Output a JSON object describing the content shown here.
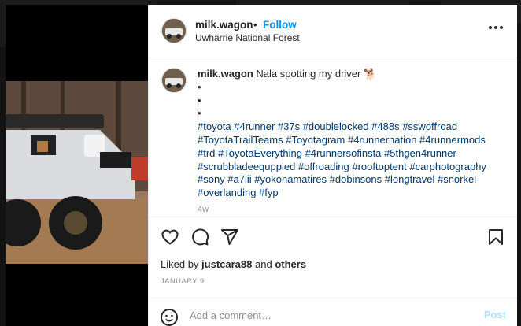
{
  "header": {
    "username": "milk.wagon",
    "separator": "•",
    "follow_label": "Follow",
    "location": "Uwharrie National Forest"
  },
  "caption": {
    "username": "milk.wagon",
    "text": "Nala spotting my driver 🐕",
    "bullets": [
      "•",
      "•",
      "•"
    ],
    "hashtags": "#toyota #4runner #37s #doublelocked #488s #sswoffroad #ToyotaTrailTeams #Toyotagram #4runnernation #4runnermods #trd #ToyotaEverything #4runnersofinsta #5thgen4runner #scrubbladeequppied #offroading #rooftoptent #carphotography #sony #a7iii #yokohamatires #dobinsons #longtravel #snorkel #overlanding #fyp",
    "age": "4w"
  },
  "likes": {
    "prefix": "Liked by",
    "user": "justcara88",
    "joiner": "and",
    "others": "others"
  },
  "date": "JANUARY 9",
  "comment_box": {
    "placeholder": "Add a comment…",
    "post_label": "Post"
  },
  "colors": {
    "accent": "#0095f6",
    "hashtag": "#00376b",
    "post_disabled": "#b2dffc"
  },
  "icons": [
    "heart-icon",
    "comment-icon",
    "share-icon",
    "bookmark-icon",
    "emoji-icon",
    "more-icon",
    "user-tag-icon"
  ]
}
